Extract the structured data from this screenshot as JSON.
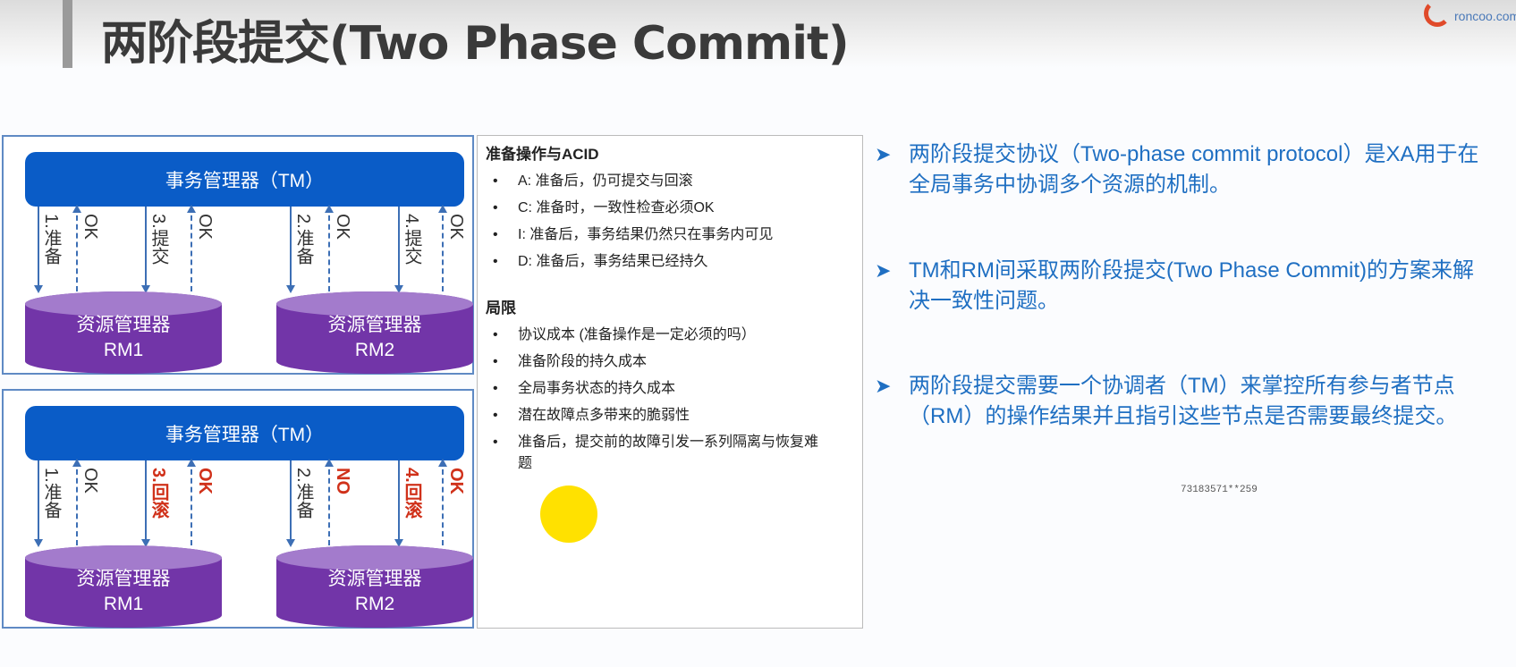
{
  "title": "两阶段提交(Two Phase Commit)",
  "logo": {
    "text": "roncoo.com"
  },
  "diagram_commit": {
    "tm": "事务管理器（TM）",
    "labels": [
      "1.准备",
      "OK",
      "3.提交",
      "OK",
      "2.准备",
      "OK",
      "4.提交",
      "OK"
    ],
    "rm1": {
      "name": "资源管理器",
      "id": "RM1"
    },
    "rm2": {
      "name": "资源管理器",
      "id": "RM2"
    }
  },
  "diagram_rollback": {
    "tm": "事务管理器（TM）",
    "labels": [
      "1.准备",
      "OK",
      "3.回滚",
      "OK",
      "2.准备",
      "NO",
      "4.回滚",
      "OK"
    ],
    "rm1": {
      "name": "资源管理器",
      "id": "RM1"
    },
    "rm2": {
      "name": "资源管理器",
      "id": "RM2"
    }
  },
  "acid": {
    "heading": "准备操作与ACID",
    "items": [
      "A: 准备后，仍可提交与回滚",
      "C: 准备时，一致性检查必须OK",
      "I: 准备后，事务结果仍然只在事务内可见",
      "D: 准备后，事务结果已经持久"
    ]
  },
  "limits": {
    "heading": "局限",
    "items": [
      "协议成本 (准备操作是一定必须的吗）",
      "准备阶段的持久成本",
      "全局事务状态的持久成本",
      "潜在故障点多带来的脆弱性",
      "准备后，提交前的故障引发一系列隔离与恢复难题"
    ]
  },
  "bullets": [
    "两阶段提交协议（Two-phase commit protocol）是XA用于在全局事务中协调多个资源的机制。",
    "TM和RM间采取两阶段提交(Two Phase Commit)的方案来解决一致性问题。",
    "两阶段提交需要一个协调者（TM）来掌控所有参与者节点（RM）的操作结果并且指引这些节点是否需要最终提交。"
  ],
  "watermark": "73183571**259"
}
